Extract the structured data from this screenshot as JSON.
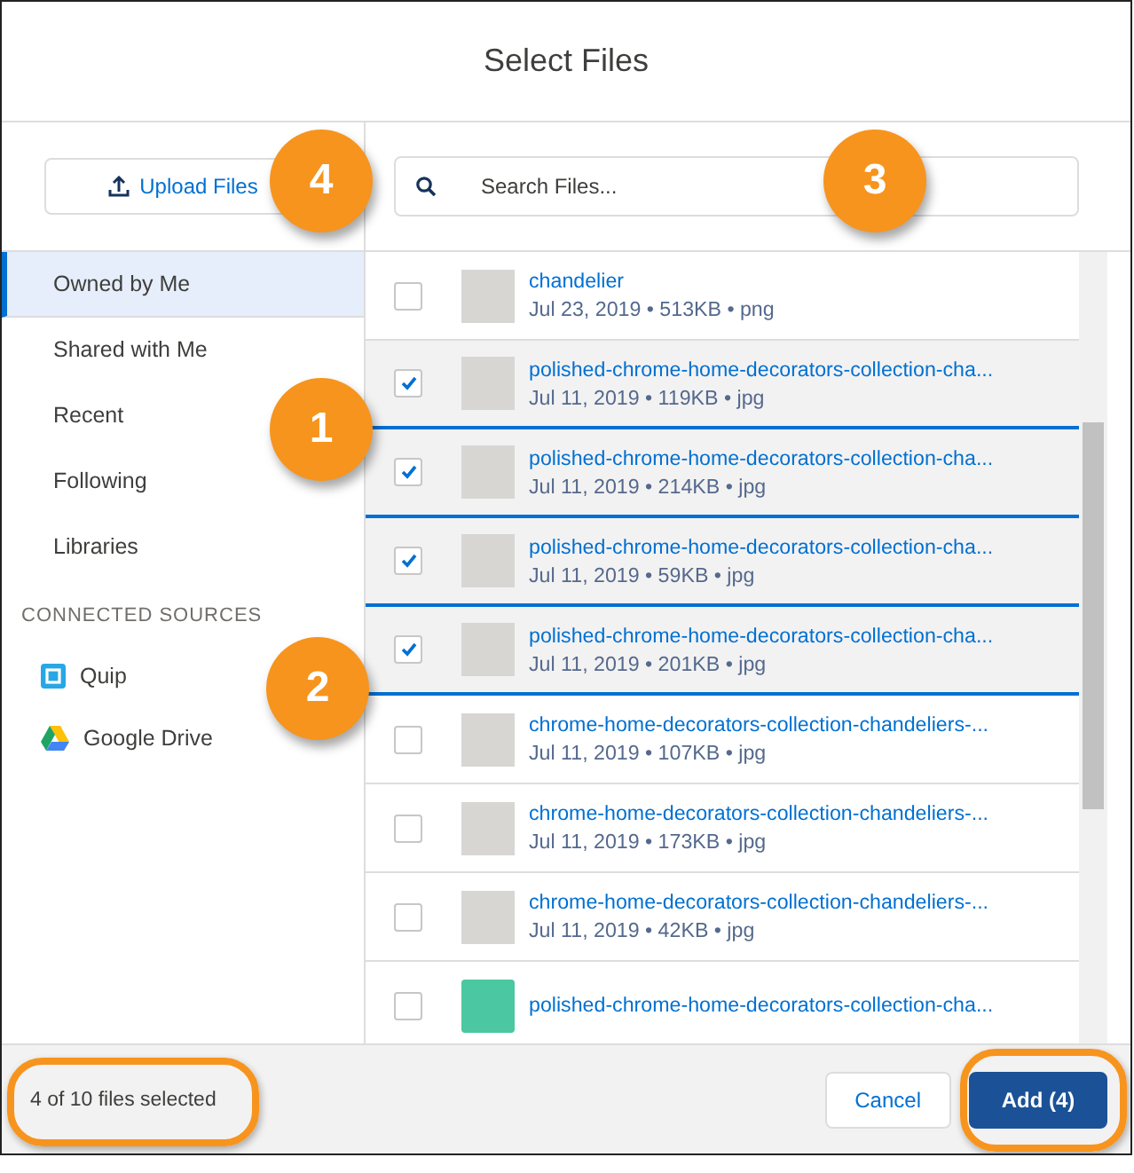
{
  "window": {
    "title": "Select Files"
  },
  "upload_button": {
    "label": "Upload Files"
  },
  "search": {
    "placeholder": "Search Files..."
  },
  "sidebar": {
    "items": [
      {
        "label": "Owned by Me",
        "selected": true
      },
      {
        "label": "Shared with Me",
        "selected": false
      },
      {
        "label": "Recent",
        "selected": false
      },
      {
        "label": "Following",
        "selected": false
      },
      {
        "label": "Libraries",
        "selected": false
      }
    ],
    "section_heading": "CONNECTED SOURCES",
    "sources": [
      {
        "label": "Quip",
        "kind": "quip"
      },
      {
        "label": "Google Drive",
        "kind": "drive"
      }
    ]
  },
  "files": [
    {
      "name": "chandelier",
      "meta": "Jul 23, 2019 • 513KB • png",
      "checked": false,
      "kind": "image"
    },
    {
      "name": "polished-chrome-home-decorators-collection-cha...",
      "meta": "Jul 11, 2019 • 119KB • jpg",
      "checked": true,
      "kind": "image"
    },
    {
      "name": "polished-chrome-home-decorators-collection-cha...",
      "meta": "Jul 11, 2019 • 214KB • jpg",
      "checked": true,
      "kind": "image"
    },
    {
      "name": "polished-chrome-home-decorators-collection-cha...",
      "meta": "Jul 11, 2019 • 59KB • jpg",
      "checked": true,
      "kind": "image"
    },
    {
      "name": "polished-chrome-home-decorators-collection-cha...",
      "meta": "Jul 11, 2019 • 201KB • jpg",
      "checked": true,
      "kind": "image"
    },
    {
      "name": "chrome-home-decorators-collection-chandeliers-...",
      "meta": "Jul 11, 2019 • 107KB • jpg",
      "checked": false,
      "kind": "image"
    },
    {
      "name": "chrome-home-decorators-collection-chandeliers-...",
      "meta": "Jul 11, 2019 • 173KB • jpg",
      "checked": false,
      "kind": "image"
    },
    {
      "name": "chrome-home-decorators-collection-chandeliers-...",
      "meta": "Jul 11, 2019 • 42KB • jpg",
      "checked": false,
      "kind": "image"
    },
    {
      "name": "polished-chrome-home-decorators-collection-cha...",
      "checked": false,
      "kind": "file"
    }
  ],
  "footer": {
    "status": "4 of 10 files selected",
    "buttons": [
      {
        "label": "Cancel",
        "kind": "neutral"
      },
      {
        "label": "Add (4)",
        "kind": "brand"
      }
    ]
  },
  "callouts": [
    "4",
    "3",
    "1",
    "2"
  ]
}
